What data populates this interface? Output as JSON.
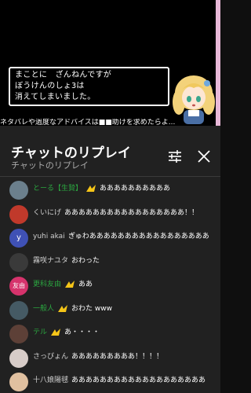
{
  "video": {
    "dialog_lines": [
      "まことに　ざんねんですが",
      "ぼうけんのしょ3は",
      "消えてしまいました。"
    ],
    "ticker": "ネタバレや過度なアドバイスは■■助けを求めたらよ..."
  },
  "panel": {
    "title": "チャットのリプレイ",
    "subtitle": "チャットのリプレイ",
    "tune_icon": "tune-icon",
    "close_icon": "close-icon"
  },
  "messages": [
    {
      "author": "とーる【生贄】",
      "text": "ああああああああああ",
      "member": true,
      "avatar_color": "#6b7f8c",
      "author_color": "#2ba640"
    },
    {
      "author": "くいにげ",
      "text": "あああああああああああああああああ！！",
      "member": false,
      "avatar_color": "#c0392b",
      "author_color": "#cfcfcf"
    },
    {
      "author": "yuhi akai",
      "text": "ぎゅわあああああああああああああああああ",
      "member": false,
      "avatar_color": "#3f51b5",
      "avatar_letter": "y",
      "author_color": "#cfcfcf"
    },
    {
      "author": "霧咲ナユタ",
      "text": "おわった",
      "member": false,
      "avatar_color": "#3a3a3a",
      "author_color": "#cfcfcf"
    },
    {
      "author": "更科友由",
      "text": "ああ",
      "member": true,
      "avatar_color": "#d6336c",
      "avatar_letter": "友由",
      "author_color": "#2ba640"
    },
    {
      "author": "一般人",
      "text": "おわた www",
      "member": true,
      "avatar_color": "#455a64",
      "author_color": "#2ba640"
    },
    {
      "author": "テル",
      "text": "あ・・・・",
      "member": true,
      "avatar_color": "#5d4037",
      "author_color": "#2ba640"
    },
    {
      "author": "さっぴょん",
      "text": "あああああああああ！！！！",
      "member": false,
      "avatar_color": "#d7ccc8",
      "author_color": "#cfcfcf"
    },
    {
      "author": "十八娘陽毬",
      "text": "あああああああああああああああああああ",
      "member": false,
      "avatar_color": "#e0c0a0",
      "author_color": "#cfcfcf"
    }
  ]
}
